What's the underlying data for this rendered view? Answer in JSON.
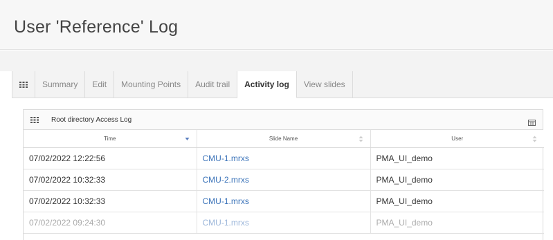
{
  "page": {
    "title": "User 'Reference' Log"
  },
  "tabs": [
    {
      "label": "Summary",
      "active": false
    },
    {
      "label": "Edit",
      "active": false
    },
    {
      "label": "Mounting Points",
      "active": false
    },
    {
      "label": "Audit trail",
      "active": false
    },
    {
      "label": "Activity log",
      "active": true
    },
    {
      "label": "View slides",
      "active": false
    }
  ],
  "panel": {
    "title": "Root directory Access Log",
    "columns": [
      "Time",
      "Slide Name",
      "User"
    ],
    "rows": [
      {
        "time": "07/02/2022 12:22:56",
        "slide": "CMU-1.mrxs",
        "user": "PMA_UI_demo"
      },
      {
        "time": "07/02/2022 10:32:33",
        "slide": "CMU-2.mrxs",
        "user": "PMA_UI_demo"
      },
      {
        "time": "07/02/2022 10:32:33",
        "slide": "CMU-1.mrxs",
        "user": "PMA_UI_demo"
      },
      {
        "time": "07/02/2022 09:24:30",
        "slide": "CMU-1.mrxs",
        "user": "PMA_UI_demo"
      }
    ]
  },
  "colors": {
    "link": "#3b73b9",
    "sort_active": "#5b7fc0"
  },
  "icons": {
    "tabs_menu": "grid-icon",
    "panel_menu": "grid-icon",
    "columns_toggle": "columns-icon",
    "sort_time": "sort-desc-icon",
    "sort_slide": "sort-both-icon",
    "sort_user": "sort-both-icon"
  }
}
